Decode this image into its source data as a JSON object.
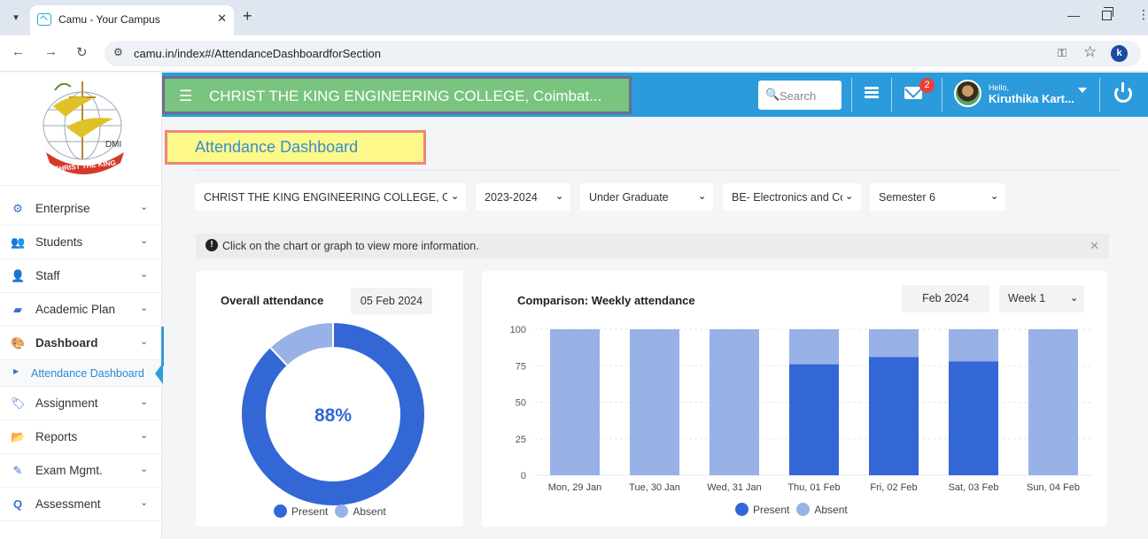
{
  "browser": {
    "tab_title": "Camu - Your Campus",
    "tab_close": "✕",
    "new_tab": "+",
    "url": "camu.in/index#/AttendanceDashboardforSection",
    "profile_initial": "k"
  },
  "sidebar": {
    "logo_text_dmi": "DMI",
    "logo_text_ribbon": "CHRIST THE KING",
    "items": [
      {
        "label": "Enterprise",
        "icon": "gears-icon"
      },
      {
        "label": "Students",
        "icon": "users-icon"
      },
      {
        "label": "Staff",
        "icon": "user-icon"
      },
      {
        "label": "Academic Plan",
        "icon": "book-icon"
      },
      {
        "label": "Dashboard",
        "icon": "palette-icon"
      },
      {
        "label": "Assignment",
        "icon": "tags-icon"
      },
      {
        "label": "Reports",
        "icon": "folder-icon"
      },
      {
        "label": "Exam Mgmt.",
        "icon": "edit-icon"
      },
      {
        "label": "Assessment",
        "icon": "search-icon"
      }
    ],
    "submenu_label": "Attendance Dashboard"
  },
  "header": {
    "college_title": "CHRIST THE KING ENGINEERING COLLEGE, Coimbat...",
    "search_placeholder": "Search",
    "notification_count": "2",
    "hello": "Hello,",
    "user_name": "Kiruthika Kart..."
  },
  "page": {
    "title": "Attendance Dashboard",
    "filters": [
      {
        "value": "CHRIST THE KING ENGINEERING COLLEGE, Coimbatore"
      },
      {
        "value": "2023-2024"
      },
      {
        "value": "Under Graduate"
      },
      {
        "value": "BE- Electronics and Communication Engineering"
      },
      {
        "value": "Semester 6"
      }
    ],
    "info_text": "Click on the chart or graph to view more information.",
    "info_close": "✕"
  },
  "overall_card": {
    "title": "Overall attendance",
    "date": "05 Feb 2024",
    "center_label": "88%"
  },
  "weekly_card": {
    "title": "Comparison: Weekly attendance",
    "month": "Feb 2024",
    "week": "Week 1"
  },
  "legend": {
    "present": "Present",
    "absent": "Absent"
  },
  "colors": {
    "present": "#3367d6",
    "absent": "#98b2e8",
    "header": "#2b9bdb"
  },
  "chart_data": [
    {
      "type": "pie",
      "title": "Overall attendance",
      "categories": [
        "Present",
        "Absent"
      ],
      "values": [
        88,
        12
      ],
      "donut": true
    },
    {
      "type": "bar",
      "title": "Comparison: Weekly attendance",
      "stacked": true,
      "categories": [
        "Mon, 29 Jan",
        "Tue, 30 Jan",
        "Wed, 31 Jan",
        "Thu, 01 Feb",
        "Fri, 02 Feb",
        "Sat, 03 Feb",
        "Sun, 04 Feb"
      ],
      "series": [
        {
          "name": "Present",
          "values": [
            0,
            0,
            0,
            76,
            81,
            78,
            0
          ]
        },
        {
          "name": "Absent",
          "values": [
            100,
            100,
            100,
            24,
            19,
            22,
            100
          ]
        }
      ],
      "yticks": [
        0,
        25,
        50,
        75,
        100
      ],
      "ylim": [
        0,
        100
      ],
      "grid": true,
      "legend": "bottom"
    }
  ]
}
